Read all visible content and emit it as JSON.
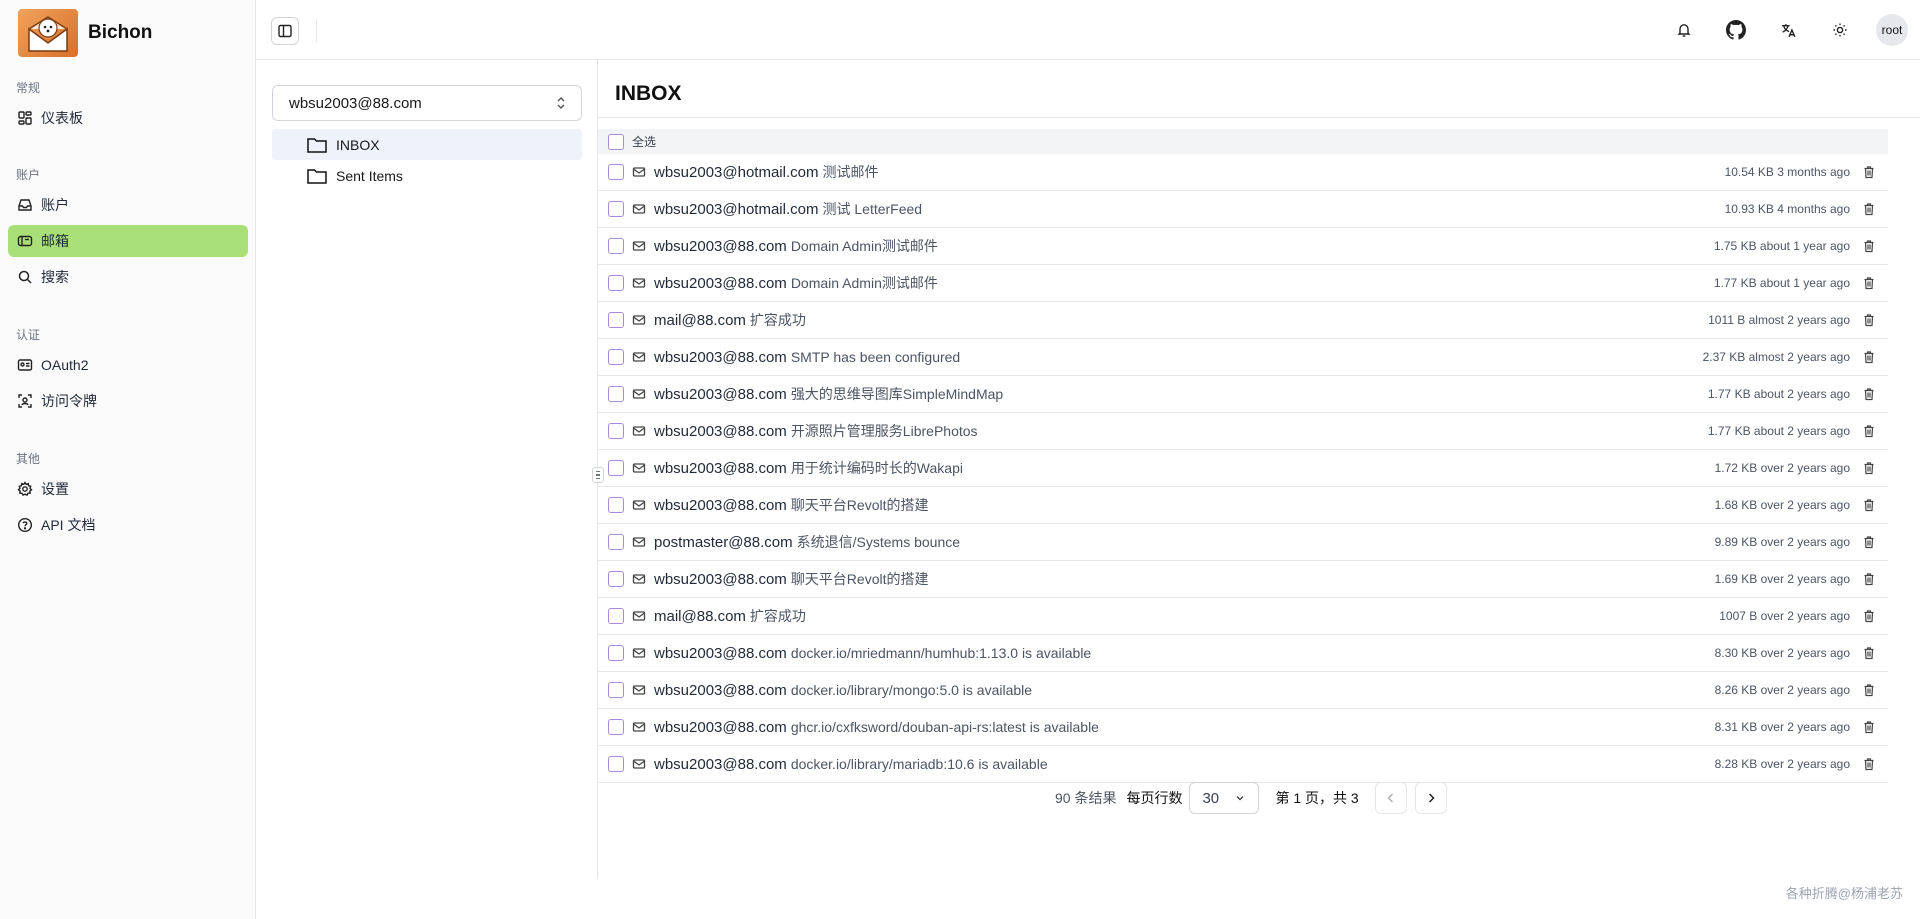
{
  "app": {
    "name": "Bichon"
  },
  "sidebar": {
    "sections": [
      {
        "title": "常规",
        "items": [
          {
            "label": "仪表板",
            "icon": "dashboard-icon"
          }
        ]
      },
      {
        "title": "账户",
        "items": [
          {
            "label": "账户",
            "icon": "inbox-icon"
          },
          {
            "label": "邮箱",
            "icon": "mailbox-icon",
            "active": true
          },
          {
            "label": "搜索",
            "icon": "search-icon"
          }
        ]
      },
      {
        "title": "认证",
        "items": [
          {
            "label": "OAuth2",
            "icon": "id-card-icon"
          },
          {
            "label": "访问令牌",
            "icon": "scan-icon"
          }
        ]
      },
      {
        "title": "其他",
        "items": [
          {
            "label": "设置",
            "icon": "gear-icon"
          },
          {
            "label": "API 文档",
            "icon": "help-circle-icon"
          }
        ]
      }
    ]
  },
  "topbar": {
    "avatar_label": "root",
    "icons": [
      "bell-icon",
      "github-icon",
      "translate-icon",
      "sun-icon"
    ]
  },
  "folders": {
    "account": "wbsu2003@88.com",
    "items": [
      {
        "label": "INBOX",
        "active": true
      },
      {
        "label": "Sent Items",
        "active": false
      }
    ]
  },
  "mail": {
    "title": "INBOX",
    "select_all_label": "全选",
    "rows": [
      {
        "sender": "wbsu2003@hotmail.com",
        "subject": "测试邮件",
        "size": "10.54 KB",
        "time": "3 months ago"
      },
      {
        "sender": "wbsu2003@hotmail.com",
        "subject": "测试 LetterFeed",
        "size": "10.93 KB",
        "time": "4 months ago"
      },
      {
        "sender": "wbsu2003@88.com",
        "subject": "Domain Admin测试邮件",
        "size": "1.75 KB",
        "time": "about 1 year ago"
      },
      {
        "sender": "wbsu2003@88.com",
        "subject": "Domain Admin测试邮件",
        "size": "1.77 KB",
        "time": "about 1 year ago"
      },
      {
        "sender": "mail@88.com",
        "subject": "扩容成功",
        "size": "1011 B",
        "time": "almost 2 years ago"
      },
      {
        "sender": "wbsu2003@88.com",
        "subject": "SMTP has been configured",
        "size": "2.37 KB",
        "time": "almost 2 years ago"
      },
      {
        "sender": "wbsu2003@88.com",
        "subject": "强大的思维导图库SimpleMindMap",
        "size": "1.77 KB",
        "time": "about 2 years ago"
      },
      {
        "sender": "wbsu2003@88.com",
        "subject": "开源照片管理服务LibrePhotos",
        "size": "1.77 KB",
        "time": "about 2 years ago"
      },
      {
        "sender": "wbsu2003@88.com",
        "subject": "用于统计编码时长的Wakapi",
        "size": "1.72 KB",
        "time": "over 2 years ago"
      },
      {
        "sender": "wbsu2003@88.com",
        "subject": "聊天平台Revolt的搭建",
        "size": "1.68 KB",
        "time": "over 2 years ago"
      },
      {
        "sender": "postmaster@88.com",
        "subject": "系统退信/Systems bounce",
        "size": "9.89 KB",
        "time": "over 2 years ago"
      },
      {
        "sender": "wbsu2003@88.com",
        "subject": "聊天平台Revolt的搭建",
        "size": "1.69 KB",
        "time": "over 2 years ago"
      },
      {
        "sender": "mail@88.com",
        "subject": "扩容成功",
        "size": "1007 B",
        "time": "over 2 years ago"
      },
      {
        "sender": "wbsu2003@88.com",
        "subject": "docker.io/mriedmann/humhub:1.13.0 is available",
        "size": "8.30 KB",
        "time": "over 2 years ago"
      },
      {
        "sender": "wbsu2003@88.com",
        "subject": "docker.io/library/mongo:5.0 is available",
        "size": "8.26 KB",
        "time": "over 2 years ago"
      },
      {
        "sender": "wbsu2003@88.com",
        "subject": "ghcr.io/cxfksword/douban-api-rs:latest is available",
        "size": "8.31 KB",
        "time": "over 2 years ago"
      },
      {
        "sender": "wbsu2003@88.com",
        "subject": "docker.io/library/mariadb:10.6 is available",
        "size": "8.28 KB",
        "time": "over 2 years ago"
      }
    ]
  },
  "pagination": {
    "results": "90 条结果",
    "per_page_label": "每页行数",
    "per_page_value": "30",
    "page_info": "第 1 页，共 3"
  },
  "watermark": "各种折腾@杨浦老苏",
  "colors": {
    "active_nav": "#a8df76",
    "checkbox": "#a78bda"
  }
}
